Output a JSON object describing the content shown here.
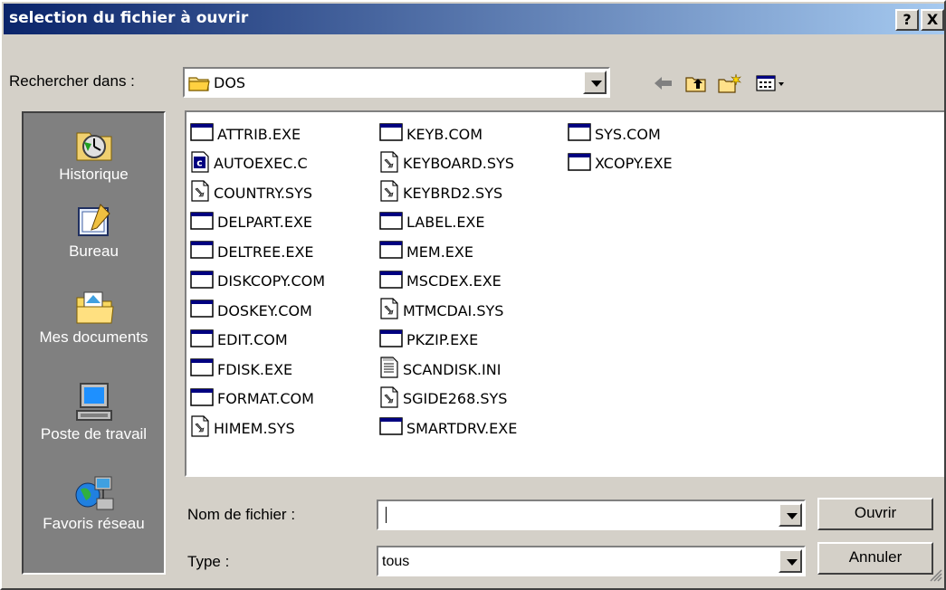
{
  "window": {
    "title": "selection du fichier à ouvrir",
    "help_label": "?",
    "close_label": "X"
  },
  "lookin": {
    "label": "Rechercher dans :",
    "value": "DOS",
    "folder_icon": "folder-icon"
  },
  "toolbar": {
    "back_icon": "back-arrow-icon",
    "up_icon": "up-folder-icon",
    "new_folder_icon": "new-folder-icon",
    "view_icon": "view-menu-icon"
  },
  "places": [
    {
      "label": "Historique",
      "icon": "history-icon"
    },
    {
      "label": "Bureau",
      "icon": "desktop-icon"
    },
    {
      "label": "Mes documents",
      "icon": "my-documents-icon"
    },
    {
      "label": "Poste de travail",
      "icon": "my-computer-icon"
    },
    {
      "label": "Favoris réseau",
      "icon": "network-places-icon"
    }
  ],
  "files": {
    "col1": [
      {
        "name": "ATTRIB.EXE",
        "type": "exe"
      },
      {
        "name": "AUTOEXEC.C",
        "type": "c"
      },
      {
        "name": "COUNTRY.SYS",
        "type": "sys"
      },
      {
        "name": "DELPART.EXE",
        "type": "exe"
      },
      {
        "name": "DELTREE.EXE",
        "type": "exe"
      },
      {
        "name": "DISKCOPY.COM",
        "type": "exe"
      },
      {
        "name": "DOSKEY.COM",
        "type": "exe"
      },
      {
        "name": "EDIT.COM",
        "type": "exe"
      },
      {
        "name": "FDISK.EXE",
        "type": "exe"
      },
      {
        "name": "FORMAT.COM",
        "type": "exe"
      },
      {
        "name": "HIMEM.SYS",
        "type": "sys"
      }
    ],
    "col2": [
      {
        "name": "KEYB.COM",
        "type": "exe"
      },
      {
        "name": "KEYBOARD.SYS",
        "type": "sys"
      },
      {
        "name": "KEYBRD2.SYS",
        "type": "sys"
      },
      {
        "name": "LABEL.EXE",
        "type": "exe"
      },
      {
        "name": "MEM.EXE",
        "type": "exe"
      },
      {
        "name": "MSCDEX.EXE",
        "type": "exe"
      },
      {
        "name": "MTMCDAI.SYS",
        "type": "sys"
      },
      {
        "name": "PKZIP.EXE",
        "type": "exe"
      },
      {
        "name": "SCANDISK.INI",
        "type": "ini"
      },
      {
        "name": "SGIDE268.SYS",
        "type": "sys"
      },
      {
        "name": "SMARTDRV.EXE",
        "type": "exe"
      }
    ],
    "col3": [
      {
        "name": "SYS.COM",
        "type": "exe"
      },
      {
        "name": "XCOPY.EXE",
        "type": "exe"
      }
    ]
  },
  "filename": {
    "label": "Nom de fichier :",
    "value": ""
  },
  "filetype": {
    "label": "Type :",
    "value": "tous"
  },
  "buttons": {
    "open": "Ouvrir",
    "cancel": "Annuler"
  },
  "colors": {
    "title_gradient_start": "#0a246a",
    "title_gradient_end": "#a6caf0",
    "face": "#d4d0c8",
    "places_bar": "#808080"
  }
}
